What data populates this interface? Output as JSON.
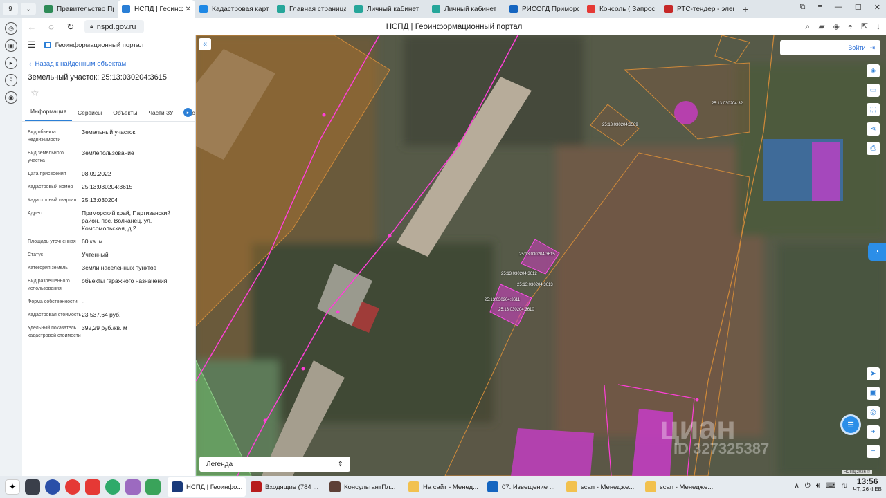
{
  "browser": {
    "tab_count": "9",
    "tabs": [
      {
        "title": "Правительство Прим",
        "color": "#2e8b57"
      },
      {
        "title": "НСПД | Геоинформ",
        "color": "#2b7fd6",
        "active": true
      },
      {
        "title": "Кадастровая карта",
        "color": "#1e88e5"
      },
      {
        "title": "Главная страница",
        "color": "#26a69a"
      },
      {
        "title": "Личный кабинет",
        "color": "#26a69a"
      },
      {
        "title": "Личный кабинет",
        "color": "#26a69a"
      },
      {
        "title": "РИСОГД Приморск",
        "color": "#1565c0"
      },
      {
        "title": "Консоль ( Запросы",
        "color": "#e53935"
      },
      {
        "title": "РТС-тендер - элект",
        "color": "#c62828"
      }
    ],
    "url": "nspd.gov.ru",
    "page_title": "НСПД | Геоинформационный портал"
  },
  "panel": {
    "portal_name": "Геоинформационный портал",
    "back_link": "Назад к найденным объектам",
    "object_title": "Земельный участок: 25:13:030204:3615",
    "tabs": [
      "Информация",
      "Сервисы",
      "Объекты",
      "Части ЗУ",
      "Соста"
    ],
    "rows": [
      {
        "k": "Вид объекта недвижимости",
        "v": "Земельный участок"
      },
      {
        "k": "Вид земельного участка",
        "v": "Землепользование"
      },
      {
        "k": "Дата присвоения",
        "v": "08.09.2022"
      },
      {
        "k": "Кадастровый номер",
        "v": "25:13:030204:3615"
      },
      {
        "k": "Кадастровый квартал",
        "v": "25:13:030204"
      },
      {
        "k": "Адрес",
        "v": "Приморский край, Партизанский район, пос. Волчанец, ул. Комсомольская, д.2"
      },
      {
        "k": "Площадь уточненная",
        "v": "60 кв. м"
      },
      {
        "k": "Статус",
        "v": "Учтенный"
      },
      {
        "k": "Категория земель",
        "v": "Земли населенных пунктов"
      },
      {
        "k": "Вид разрешенного использования",
        "v": "объекты гаражного назначения"
      },
      {
        "k": "Форма собственности",
        "v": "-"
      },
      {
        "k": "Кадастровая стоимость",
        "v": "23 537,64 руб."
      },
      {
        "k": "Удельный показатель кадастровой стоимости",
        "v": "392,29 руб./кв. м"
      }
    ]
  },
  "map": {
    "login_label": "Войти",
    "legend_label": "Легенда",
    "scale_text": "НСПД 2026 ©",
    "watermark": "циан",
    "watermark_id": "ID 327325387",
    "parcel_labels": [
      "25:13:030204:3589",
      "25:13:030204:32",
      "25:13:030204:3615",
      "25:13:030204:3612",
      "25:13:030204:3613",
      "25:13:030204:3611",
      "25:13:030204:3610"
    ]
  },
  "taskbar": {
    "tasks": [
      {
        "title": "НСПД | Геоинфо...",
        "color": "#1a3a7a",
        "active": true
      },
      {
        "title": "Входящие (784 ...",
        "color": "#b71c1c"
      },
      {
        "title": "КонсультантПл...",
        "color": "#5d4037"
      },
      {
        "title": "На сайт - Менед...",
        "color": "#f2c14e"
      },
      {
        "title": "07. Извещение ...",
        "color": "#1565c0"
      },
      {
        "title": "scan - Менедже...",
        "color": "#f2c14e"
      },
      {
        "title": "scan - Менедже...",
        "color": "#f2c14e"
      }
    ],
    "lang": "ru",
    "time": "13:56",
    "date": "ЧТ, 26 ФЕВ"
  }
}
